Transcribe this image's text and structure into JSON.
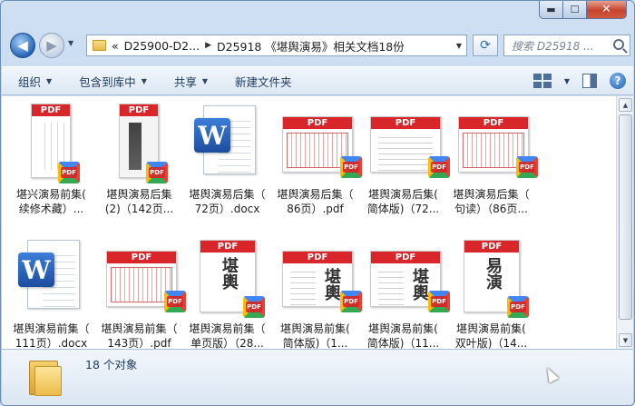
{
  "address": {
    "crumbs": [
      "«",
      "D25900-D2...",
      "D25918 《堪舆演易》相关文档18份"
    ]
  },
  "search": {
    "placeholder": "搜索 D25918 ..."
  },
  "toolbar": {
    "organize": "组织",
    "include_in_library": "包含到库中",
    "share": "共享",
    "new_folder": "新建文件夹"
  },
  "files": [
    {
      "line1": "堪兴演易前集(",
      "line2": "续修术藏）...",
      "type": "pdf",
      "thumb": "scan-small"
    },
    {
      "line1": "堪舆演易后集",
      "line2": "(2)（142页...",
      "type": "pdf",
      "thumb": "cover"
    },
    {
      "line1": "堪舆演易后集（",
      "line2": "72页）.docx",
      "type": "docx",
      "thumb": "word"
    },
    {
      "line1": "堪舆演易后集（",
      "line2": "86页）.pdf",
      "type": "pdf",
      "thumb": "redrules"
    },
    {
      "line1": "堪舆演易后集(",
      "line2": "简体版)（72...",
      "type": "pdf",
      "thumb": "textpage"
    },
    {
      "line1": "堪舆演易后集（",
      "line2": "句读）（86页...",
      "type": "pdf",
      "thumb": "redrules"
    },
    {
      "line1": "堪舆演易前集（",
      "line2": "111页）.docx",
      "type": "docx",
      "thumb": "word"
    },
    {
      "line1": "堪舆演易前集（",
      "line2": "143页）.pdf",
      "type": "pdf",
      "thumb": "redrules"
    },
    {
      "line1": "堪舆演易前集（",
      "line2": "单页版）（28...",
      "type": "pdf",
      "thumb": "calligraphy"
    },
    {
      "line1": "堪舆演易前集(",
      "line2": "简体版)（1...",
      "type": "pdf",
      "thumb": "textcalli"
    },
    {
      "line1": "堪舆演易前集(",
      "line2": "简体版)（11...",
      "type": "pdf",
      "thumb": "textcalli"
    },
    {
      "line1": "堪舆演易前集(",
      "line2": "双叶版)（14...",
      "type": "pdf",
      "thumb": "calligraphy2"
    }
  ],
  "thumb_text": {
    "pdf": "PDF",
    "word_letter": "W",
    "calli": "堪輿",
    "calli2": "易演"
  },
  "status": {
    "count": "18 个对象"
  },
  "colors": {
    "pdf_red": "#d8262a",
    "accent": "#2766b8"
  }
}
